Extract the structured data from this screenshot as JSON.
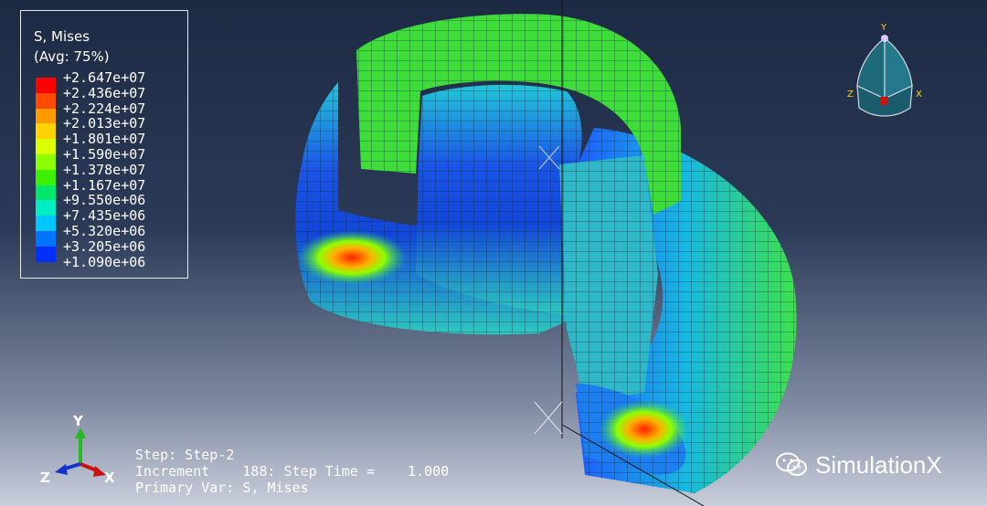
{
  "legend": {
    "title": "S, Mises",
    "subtitle": "(Avg: 75%)",
    "ticks": [
      "+2.647e+07",
      "+2.436e+07",
      "+2.224e+07",
      "+2.013e+07",
      "+1.801e+07",
      "+1.590e+07",
      "+1.378e+07",
      "+1.167e+07",
      "+9.550e+06",
      "+7.435e+06",
      "+5.320e+06",
      "+3.205e+06",
      "+1.090e+06"
    ],
    "colors": [
      "#ff0000",
      "#ff4a00",
      "#ff9a00",
      "#ffd200",
      "#d9ff00",
      "#8cff00",
      "#3cf000",
      "#00e86a",
      "#00eec4",
      "#00c8ff",
      "#0074ff",
      "#0030ff"
    ]
  },
  "status": {
    "step": "Step: Step-2",
    "increment": "Increment    188: Step Time =    1.000",
    "primary_var": "Primary Var: S, Mises"
  },
  "triad": {
    "y": "Y",
    "z": "Z",
    "x": "X"
  },
  "view_cube": {
    "y": "Y",
    "z": "Z",
    "x": "X"
  },
  "watermark": {
    "text": "SimulationX",
    "icon": "wechat-icon"
  }
}
